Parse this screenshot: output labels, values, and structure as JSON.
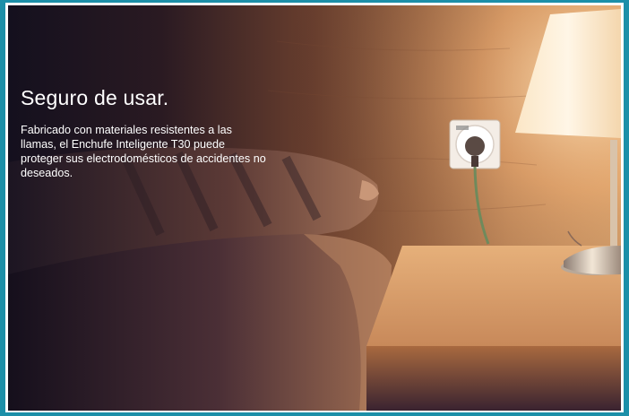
{
  "section": {
    "headline": "Seguro de usar.",
    "description": "Fabricado con materiales resistentes a las llamas, el Enchufe Inteligente T30 puede proteger sus electrodomésticos de accidentes no deseados."
  },
  "image": {
    "subject": "smart-plug-on-bedroom-wall",
    "icons": [
      "smart-plug-icon",
      "bedside-lamp-icon",
      "pillow-icon",
      "nightstand-icon"
    ]
  },
  "colors": {
    "frame_border": "#1c8fa8",
    "headline_text": "#ffffff",
    "lamp_glow": "#fff3d6",
    "wall_warm": "#c98e5b"
  }
}
